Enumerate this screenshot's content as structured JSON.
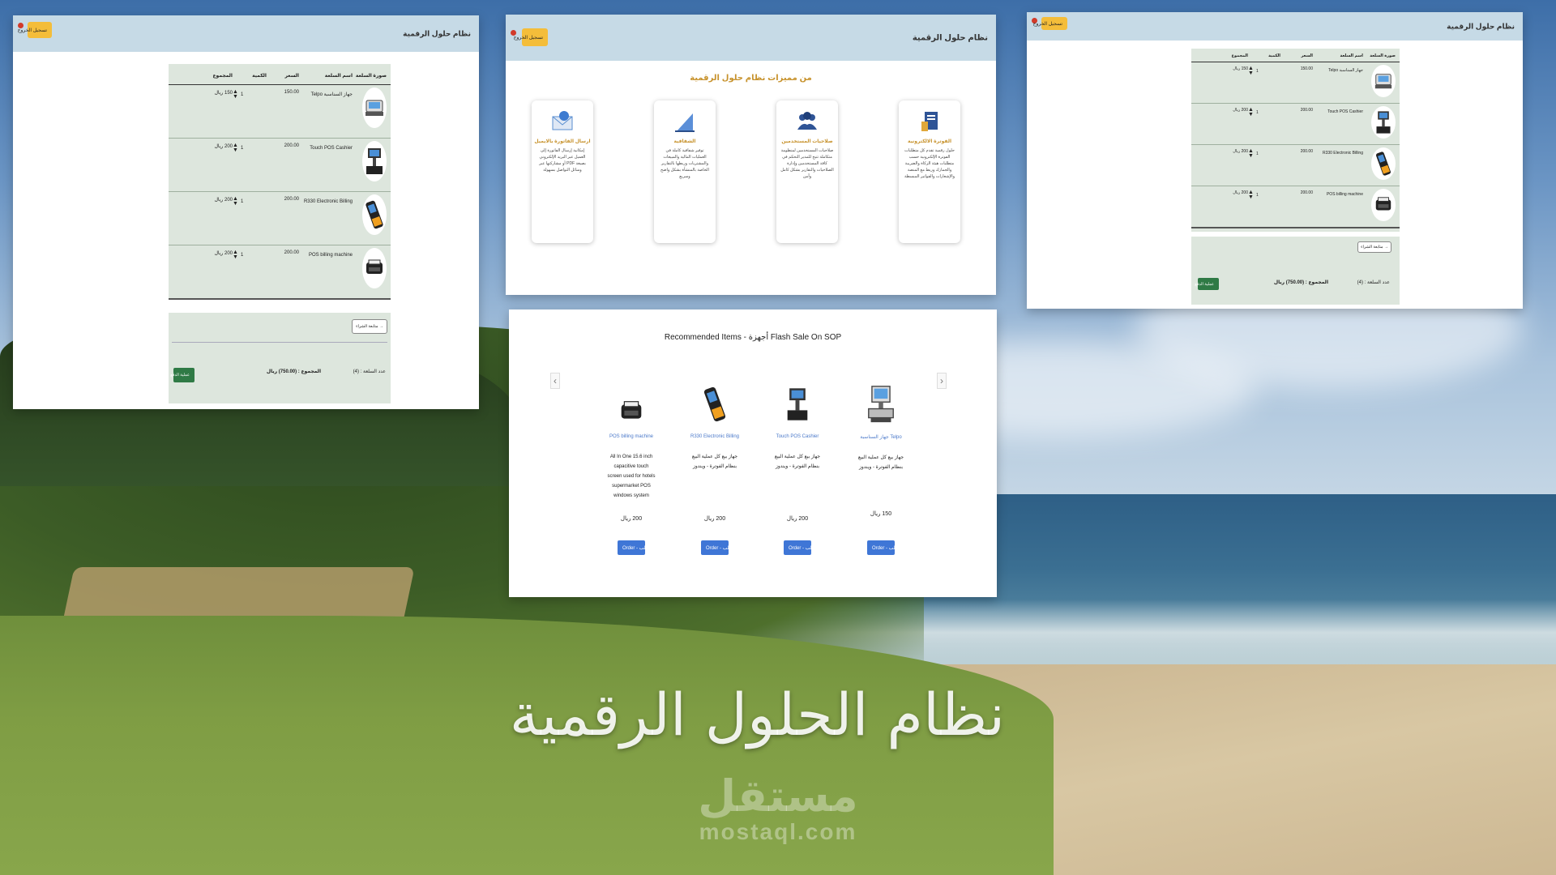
{
  "hero": {
    "title": "نظام الحلول الرقمية",
    "watermark_ar": "مستقل",
    "watermark_en": "mostaql.com"
  },
  "app": {
    "brand": "نظام حلول الرقمية",
    "logout_label": "تسجيل الخروج"
  },
  "cart": {
    "headers": [
      "صورة السلعة",
      "اسم السلعة",
      "السعر",
      "الكمية",
      "المجموع"
    ],
    "rows": [
      {
        "name": "جهاز السناسبة Telpo",
        "price": "150.00",
        "qty": "1",
        "total": "150 ريال",
        "icon": "telpo-terminal-icon"
      },
      {
        "name": "Touch POS Cashier",
        "price": "200.00",
        "qty": "1",
        "total": "200 ريال",
        "icon": "pos-cashier-icon"
      },
      {
        "name": "R330 Electronic Billing",
        "price": "200.00",
        "qty": "1",
        "total": "200 ريال",
        "icon": "r330-handheld-icon"
      },
      {
        "name": "POS billing machine",
        "price": "200.00",
        "qty": "1",
        "total": "200 ريال",
        "icon": "pos-billing-machine-icon"
      }
    ],
    "continue_label": "→ متابعة الشراء",
    "count_label": "عدد السلعة : (4)",
    "total_label": "المجموع : (750.00) ريال",
    "checkout_label": "عملية الدفع"
  },
  "features": {
    "title": "من مميزات نظام حلول الرقمية",
    "cards": [
      {
        "title": "الفوترة الالكترونية",
        "desc": "حلول رقمية تقدم كل متطلبات الفوترة الإلكترونية حسب متطلبات هيئة الزكاة والضريبة والجمارك وربط مع المنصة والإشعارات والفواتير المبسطة",
        "icon": "invoice-icon"
      },
      {
        "title": "صلاحيات المستخدمين",
        "desc": "صلاحيات المستخدمين لمنظومة متكاملة تتيح للمدير التحكم في كافة المستخدمين وإدارة الصلاحيات والتقارير بشكل كامل وآمن",
        "icon": "users-icon"
      },
      {
        "title": "الشفافية",
        "desc": "توفير شفافية كاملة في العمليات المالية والمبيعات والمشتريات وربطها بالتقارير الخاصة بالمنشأة بشكل واضح وسريع",
        "icon": "chart-icon"
      },
      {
        "title": "ارسال الفاتورة بالايميل",
        "desc": "إمكانية إرسال الفاتورة إلى العميل عبر البريد الإلكتروني بصيغة PDF أو مشاركتها عبر وسائل التواصل بسهولة",
        "icon": "email-icon"
      }
    ]
  },
  "recommended": {
    "title": "Recommended Items - أجهزة Flash Sale On SOP",
    "items": [
      {
        "name": "جهاز السناسبة Telpo",
        "desc": "جهاز بيع كل عملية البيع بنظام الفوترة - ويندوز",
        "price": "150 ريال",
        "order": "Order - طلب",
        "icon": "telpo-terminal-icon"
      },
      {
        "name": "Touch POS Cashier",
        "desc": "جهاز بيع كل عملية البيع بنظام الفوترة - ويندوز",
        "price": "200 ريال",
        "order": "Order - طلب",
        "icon": "pos-cashier-icon"
      },
      {
        "name": "R330 Electronic Billing",
        "desc": "جهاز بيع كل عملية البيع بنظام الفوترة - ويندوز",
        "price": "200 ريال",
        "order": "Order - طلب",
        "icon": "r330-handheld-icon"
      },
      {
        "name": "POS billing machine",
        "desc": "All In One 15.6 inch capacitive touch screen used for hotels supermarket POS windows system",
        "price": "200 ريال",
        "order": "Order - طلب",
        "icon": "pos-billing-machine-icon"
      }
    ]
  }
}
